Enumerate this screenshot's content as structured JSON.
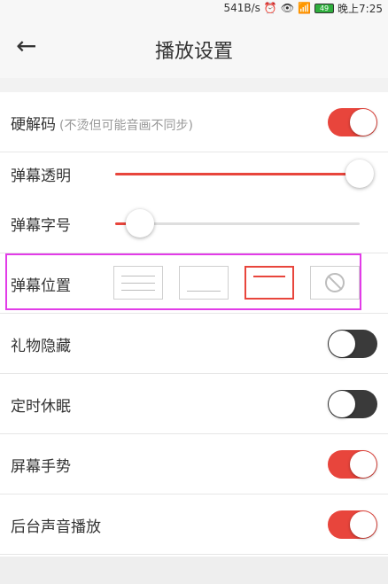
{
  "status_bar": {
    "speed": "541B/s",
    "time": "晚上7:25",
    "battery": "49"
  },
  "header": {
    "title": "播放设置"
  },
  "settings": {
    "hw_decode": {
      "label": "硬解码",
      "hint": "(不烫但可能音画不同步)",
      "on": true
    },
    "danmaku_opacity": {
      "label": "弹幕透明",
      "value": 1.0
    },
    "danmaku_font_size": {
      "label": "弹幕字号",
      "value": 0.1
    },
    "danmaku_position": {
      "label": "弹幕位置",
      "options": [
        "full",
        "bottom",
        "top",
        "off"
      ],
      "selected": "top"
    },
    "hide_gifts": {
      "label": "礼物隐藏",
      "on": false
    },
    "sleep_timer": {
      "label": "定时休眠",
      "on": false
    },
    "screen_gestures": {
      "label": "屏幕手势",
      "on": true
    },
    "background_audio": {
      "label": "后台声音播放",
      "on": true
    }
  },
  "colors": {
    "accent": "#e8453c",
    "highlight": "#e23ce8"
  }
}
